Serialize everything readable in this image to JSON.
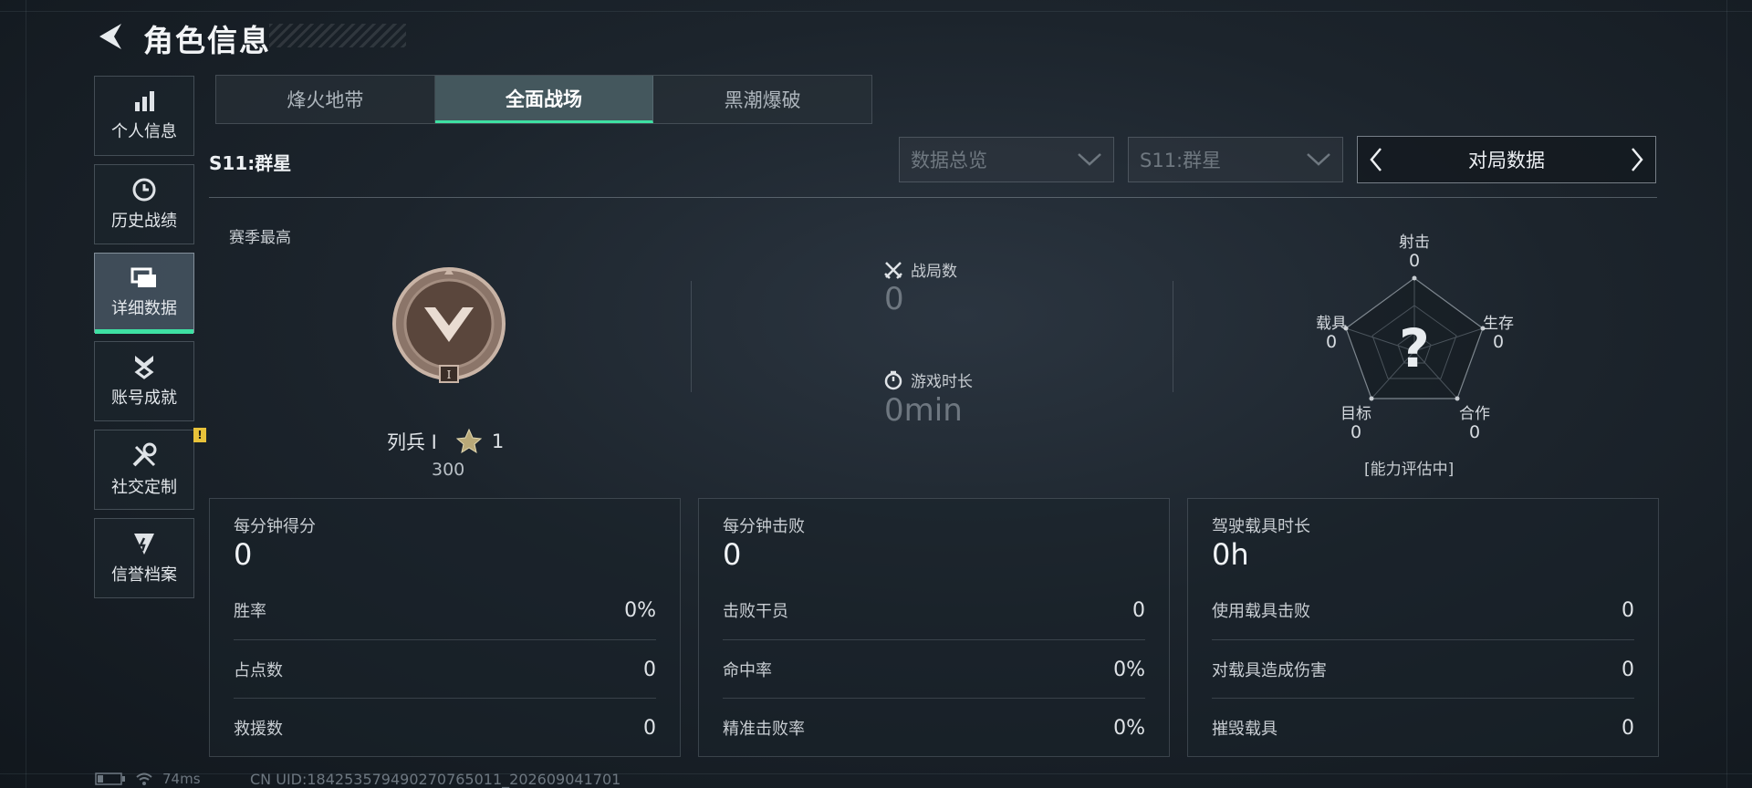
{
  "header": {
    "title": "角色信息"
  },
  "sidebar": {
    "items": [
      {
        "label": "个人信息",
        "icon": "bar-chart-icon"
      },
      {
        "label": "历史战绩",
        "icon": "clock-icon"
      },
      {
        "label": "详细数据",
        "icon": "folders-icon",
        "active": true
      },
      {
        "label": "账号成就",
        "icon": "medal-icon"
      },
      {
        "label": "社交定制",
        "icon": "tools-icon",
        "badge": "!"
      },
      {
        "label": "信誉档案",
        "icon": "shield-icon"
      }
    ]
  },
  "tabs": [
    {
      "label": "烽火地带"
    },
    {
      "label": "全面战场",
      "active": true
    },
    {
      "label": "黑潮爆破"
    }
  ],
  "season": {
    "label": "S11:群星"
  },
  "filters": {
    "dropdown1": "数据总览",
    "dropdown2": "S11:群星",
    "pager_label": "对局数据"
  },
  "rank": {
    "section_label": "赛季最高",
    "rank_name": "列兵 I",
    "stars": "1",
    "points": "300",
    "badge_numeral": "I"
  },
  "summary": {
    "matches_label": "战局数",
    "matches_value": "0",
    "playtime_label": "游戏时长",
    "playtime_value": "0min"
  },
  "radar": {
    "axes": [
      {
        "label": "射击",
        "value": "0"
      },
      {
        "label": "生存",
        "value": "0"
      },
      {
        "label": "合作",
        "value": "0"
      },
      {
        "label": "目标",
        "value": "0"
      },
      {
        "label": "载具",
        "value": "0"
      }
    ],
    "center_mark": "?",
    "caption": "[能力评估中]"
  },
  "cards": [
    {
      "title": "每分钟得分",
      "value": "0",
      "rows": [
        {
          "label": "胜率",
          "value": "0%"
        },
        {
          "label": "占点数",
          "value": "0"
        },
        {
          "label": "救援数",
          "value": "0"
        }
      ]
    },
    {
      "title": "每分钟击败",
      "value": "0",
      "rows": [
        {
          "label": "击败干员",
          "value": "0"
        },
        {
          "label": "命中率",
          "value": "0%"
        },
        {
          "label": "精准击败率",
          "value": "0%"
        }
      ]
    },
    {
      "title": "驾驶载具时长",
      "value": "0h",
      "rows": [
        {
          "label": "使用载具击败",
          "value": "0"
        },
        {
          "label": "对载具造成伤害",
          "value": "0"
        },
        {
          "label": "摧毁载具",
          "value": "0"
        }
      ]
    }
  ],
  "status_bar": {
    "ping": "74ms",
    "uid": "CN UID:184253579490270765011_202609041701"
  },
  "colors": {
    "accent": "#3ee0a3",
    "warning": "#e8c23a",
    "background": "#1c242c"
  }
}
